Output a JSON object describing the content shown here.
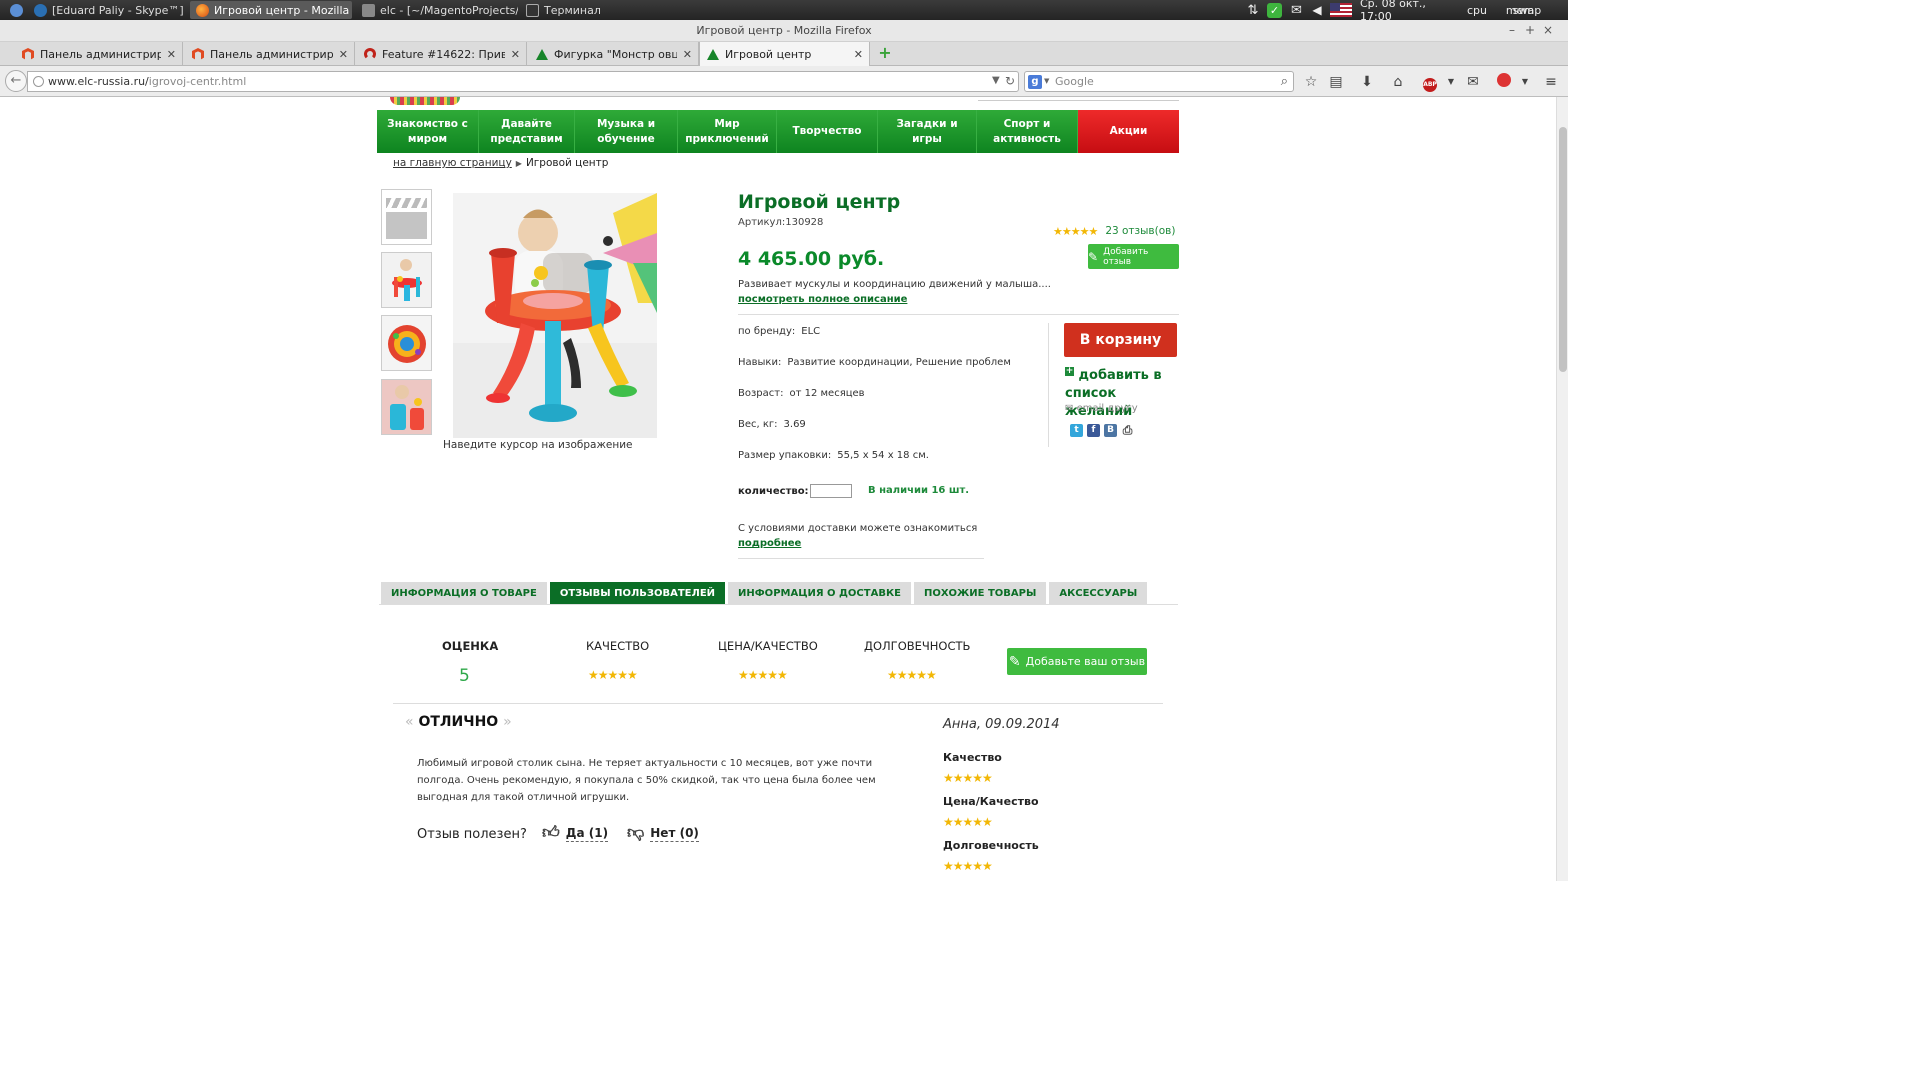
{
  "taskbar": {
    "tasks": [
      {
        "label": "[Eduard Paliy - Skype™]"
      },
      {
        "label": "Игровой центр - Mozilla F..."
      },
      {
        "label": "elc - [~/MagentoProjects/el..."
      },
      {
        "label": "Терминал"
      }
    ],
    "datetime": "Ср. 08 окт., 17:00",
    "cpu_label": "cpu",
    "mem_label": "mem",
    "swap_label": "swap"
  },
  "window": {
    "title": "Игровой центр - Mozilla Firefox"
  },
  "browser_tabs": [
    {
      "label": "Панель администриро...",
      "icon": "magento-icon"
    },
    {
      "label": "Панель администриро...",
      "icon": "magento-icon"
    },
    {
      "label": "Feature #14622: Привя...",
      "icon": "redmine-icon"
    },
    {
      "label": "Фигурка \"Монстр овца\"",
      "icon": "elc-icon"
    },
    {
      "label": "Игровой центр",
      "icon": "elc-icon",
      "active": true
    }
  ],
  "navbar": {
    "url_host": "www.elc-russia.ru/",
    "url_path": "igrovoj-centr.html",
    "search_placeholder": "Google"
  },
  "site": {
    "menu": [
      "Знакомство с\nмиром",
      "Давайте\nпредставим",
      "Музыка и\nобучение",
      "Мир приключений",
      "Творчество",
      "Загадки и игры",
      "Спорт и\nактивность",
      "Акции"
    ],
    "breadcrumb": {
      "home": "на главную страницу",
      "current": "Игровой центр"
    }
  },
  "product": {
    "title": "Игровой центр",
    "sku": "Артикул:130928",
    "rating": 5,
    "reviews_link": "23 отзыв(ов)",
    "add_review": "Добавить отзыв",
    "price": "4 465.00 руб.",
    "short_desc": "Развивает мускулы и координацию движений у малыша....",
    "full_desc_link": "посмотреть полное описание",
    "hover_caption": "Наведите курсор на изображение",
    "attributes": [
      {
        "label": "по бренду:",
        "value": "ELC"
      },
      {
        "label": "Навыки:",
        "value": "Развитие координации, Решение проблем"
      },
      {
        "label": "Возраст:",
        "value": "от 12 месяцев"
      },
      {
        "label": "Вес, кг:",
        "value": "3.69"
      },
      {
        "label": "Размер упаковки:",
        "value": "55,5 x 54 x 18 см."
      }
    ],
    "qty_label": "количество:",
    "qty_value": "",
    "stock": "В наличии 16 шт.",
    "delivery_text": "С условиями доставки можете ознакомиться",
    "delivery_link": "подробнее",
    "to_cart": "В корзину",
    "wishlist": "добавить в список желаний",
    "email_friend": "email другу"
  },
  "tabs": [
    {
      "label": "ИНФОРМАЦИЯ О ТОВАРЕ"
    },
    {
      "label": "ОТЗЫВЫ ПОЛЬЗОВАТЕЛЕЙ",
      "active": true
    },
    {
      "label": "ИНФОРМАЦИЯ О ДОСТАВКЕ"
    },
    {
      "label": "ПОХОЖИЕ ТОВАРЫ"
    },
    {
      "label": "АКСЕССУАРЫ"
    }
  ],
  "reviews": {
    "score_label": "ОЦЕНКА",
    "score_value": "5",
    "quality_label": "КАЧЕСТВО",
    "quality_stars": 5,
    "price_quality_label": "ЦЕНА/КАЧЕСТВО",
    "price_quality_stars": 5,
    "durability_label": "ДОЛГОВЕЧНОСТЬ",
    "durability_stars": 5,
    "add_your_review": "Добавьте ваш отзыв",
    "item": {
      "title": "ОТЛИЧНО",
      "author_date": "Анна, 09.09.2014",
      "text": "Любимый игровой столик сына. Не теряет актуальности с 10 месяцев, вот уже почти полгода. Очень рекомендую, я покупала с 50% скидкой, так что цена была более чем выгодная для такой отличной игрушки.",
      "helpful_label": "Отзыв полезен?",
      "yes": "Да (1)",
      "no": "Нет (0)",
      "criteria": [
        {
          "label": "Качество",
          "stars": 5
        },
        {
          "label": "Цена/Качество",
          "stars": 5
        },
        {
          "label": "Долговечность",
          "stars": 5
        }
      ]
    }
  },
  "colors": {
    "brand_green": "#0b6e26",
    "menu_green": "#1e9a2e",
    "promo_red": "#d8161c",
    "cart_red": "#d0301e",
    "star_gold": "#f2b705"
  }
}
